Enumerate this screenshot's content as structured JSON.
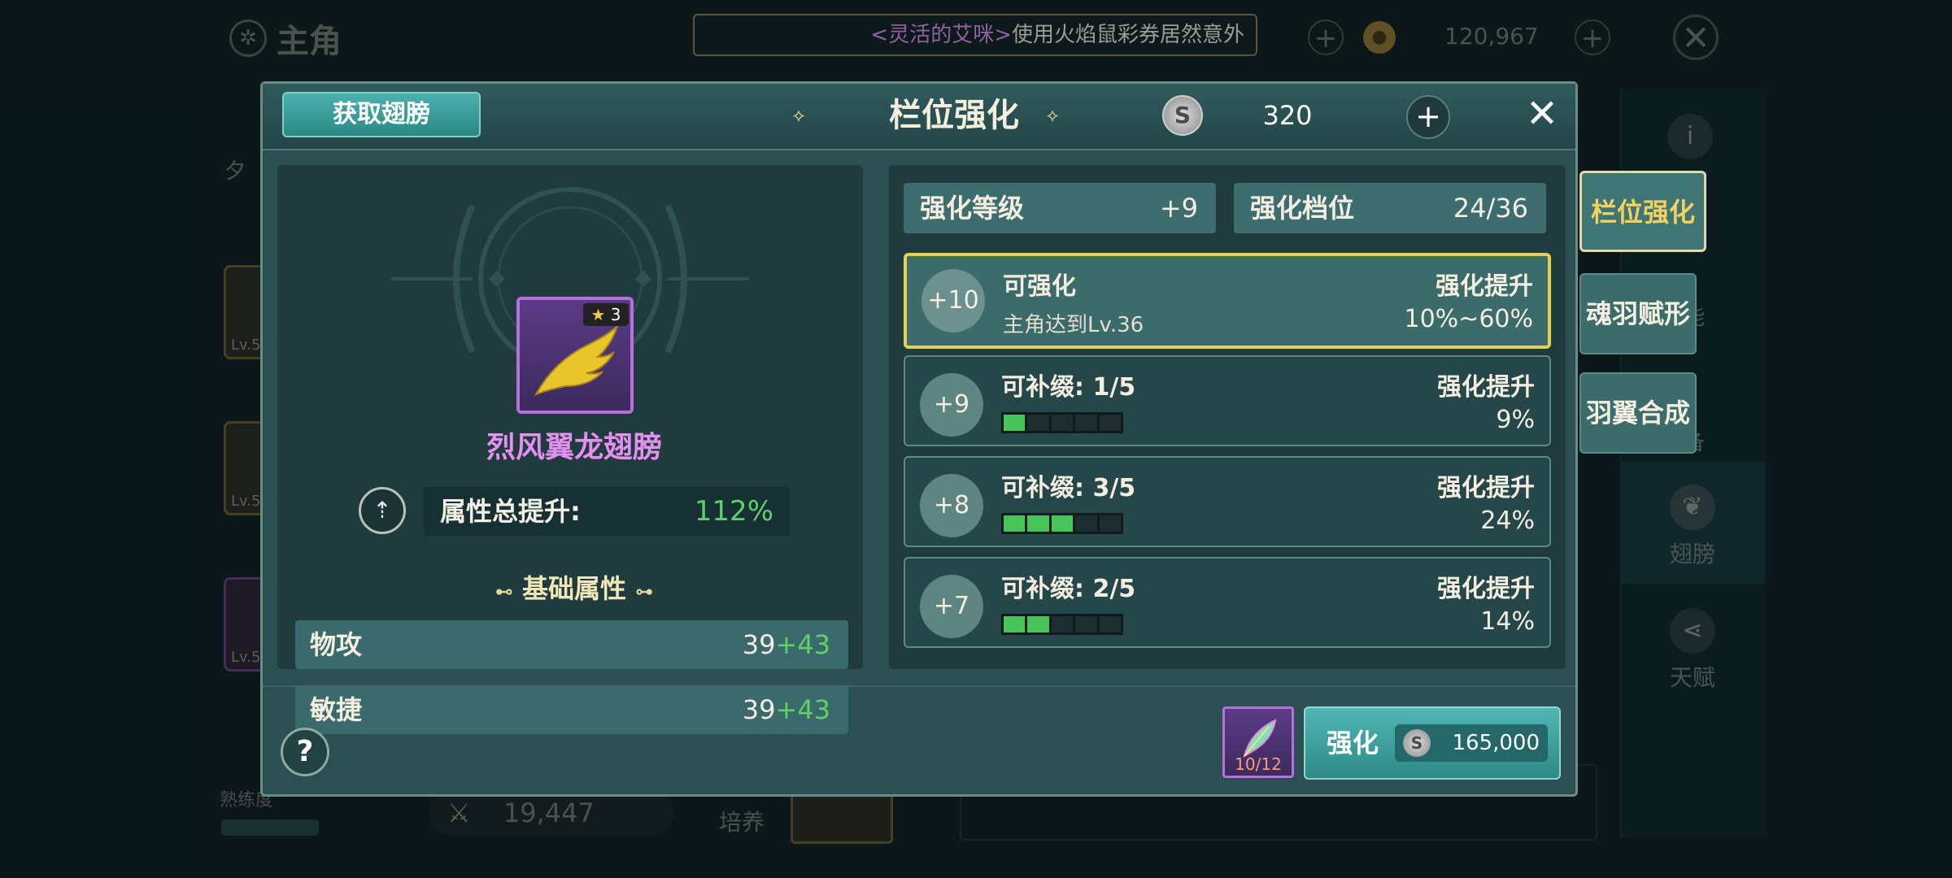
{
  "background": {
    "title": "主角",
    "ticker_name": "<灵活的艾咪>",
    "ticker_text": "使用火焰鼠彩券居然意外",
    "coins": "120,967",
    "left_cards": [
      "Lv.5",
      "Lv.5",
      "Lv.5"
    ],
    "left_partial": "夕",
    "right_tabs": [
      "翅膀",
      "天赋"
    ],
    "right_partial_1": "能",
    "right_partial_2": "备",
    "power": "19,447",
    "peiyang": "培养",
    "shuliandu": "熟练度"
  },
  "modal": {
    "get_wings_label": "获取翅膀",
    "title": "栏位强化",
    "currency_value": "320",
    "currency_plus": "+",
    "close": "✕",
    "item": {
      "stars": "3",
      "name": "烈风翼龙翅膀"
    },
    "total_attr_label": "属性总提升:",
    "total_attr_value": "112%",
    "base_attr_title": "基础属性",
    "stats": [
      {
        "name": "物攻",
        "base": "39",
        "bonus": "+43"
      },
      {
        "name": "敏捷",
        "base": "39",
        "bonus": "+43"
      }
    ],
    "enhance_level_label": "强化等级",
    "enhance_level_value": "+9",
    "enhance_tier_label": "强化档位",
    "enhance_tier_value": "24/36",
    "slots": [
      {
        "level": "+10",
        "title": "可强化",
        "sub": "主角达到Lv.36",
        "right_label": "强化提升",
        "right_value": "10%~60%"
      },
      {
        "level": "+9",
        "title": "可补缀: 1/5",
        "right_label": "强化提升",
        "right_value": "9%",
        "filled": 1,
        "total": 5
      },
      {
        "level": "+8",
        "title": "可补缀: 3/5",
        "right_label": "强化提升",
        "right_value": "24%",
        "filled": 3,
        "total": 5
      },
      {
        "level": "+7",
        "title": "可补缀: 2/5",
        "right_label": "强化提升",
        "right_value": "14%",
        "filled": 2,
        "total": 5
      }
    ],
    "help": "?",
    "material_count": "10/12",
    "enhance_button": "强化",
    "enhance_cost": "165,000"
  },
  "side_tabs": [
    "栏位强化",
    "魂羽赋形",
    "羽翼合成"
  ],
  "colors": {
    "accent_gold": "#e8cf4f",
    "green_value": "#5fd06a",
    "purple_name": "#e58ff0"
  }
}
